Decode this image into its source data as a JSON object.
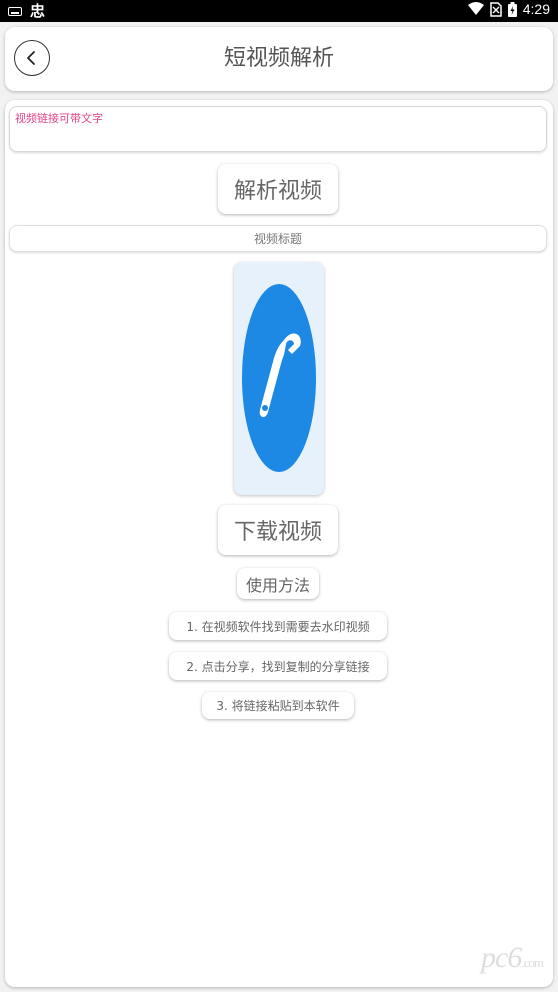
{
  "status_bar": {
    "time": "4:29",
    "app_glyph": "忠",
    "icons": [
      "keyboard-icon",
      "wifi-icon",
      "no-sim-icon",
      "battery-icon"
    ]
  },
  "header": {
    "title": "短视频解析",
    "back_icon": "chevron-left-icon"
  },
  "main": {
    "url_input": {
      "value": "",
      "placeholder": "视频链接可带文字"
    },
    "parse_button": "解析视频",
    "video_title": "视频标题",
    "thumbnail_icon": "wrench-icon",
    "download_button": "下载视频",
    "howto_button": "使用方法",
    "steps": [
      "1. 在视频软件找到需要去水印视频",
      "2. 点击分享，找到复制的分享链接",
      "3. 将链接粘贴到本软件"
    ]
  },
  "watermark": {
    "text": "pc6",
    "suffix": ".com"
  },
  "colors": {
    "accent_blue": "#1e88e5",
    "placeholder_pink": "#e0458c",
    "thumb_bg": "#e6f1fb"
  }
}
